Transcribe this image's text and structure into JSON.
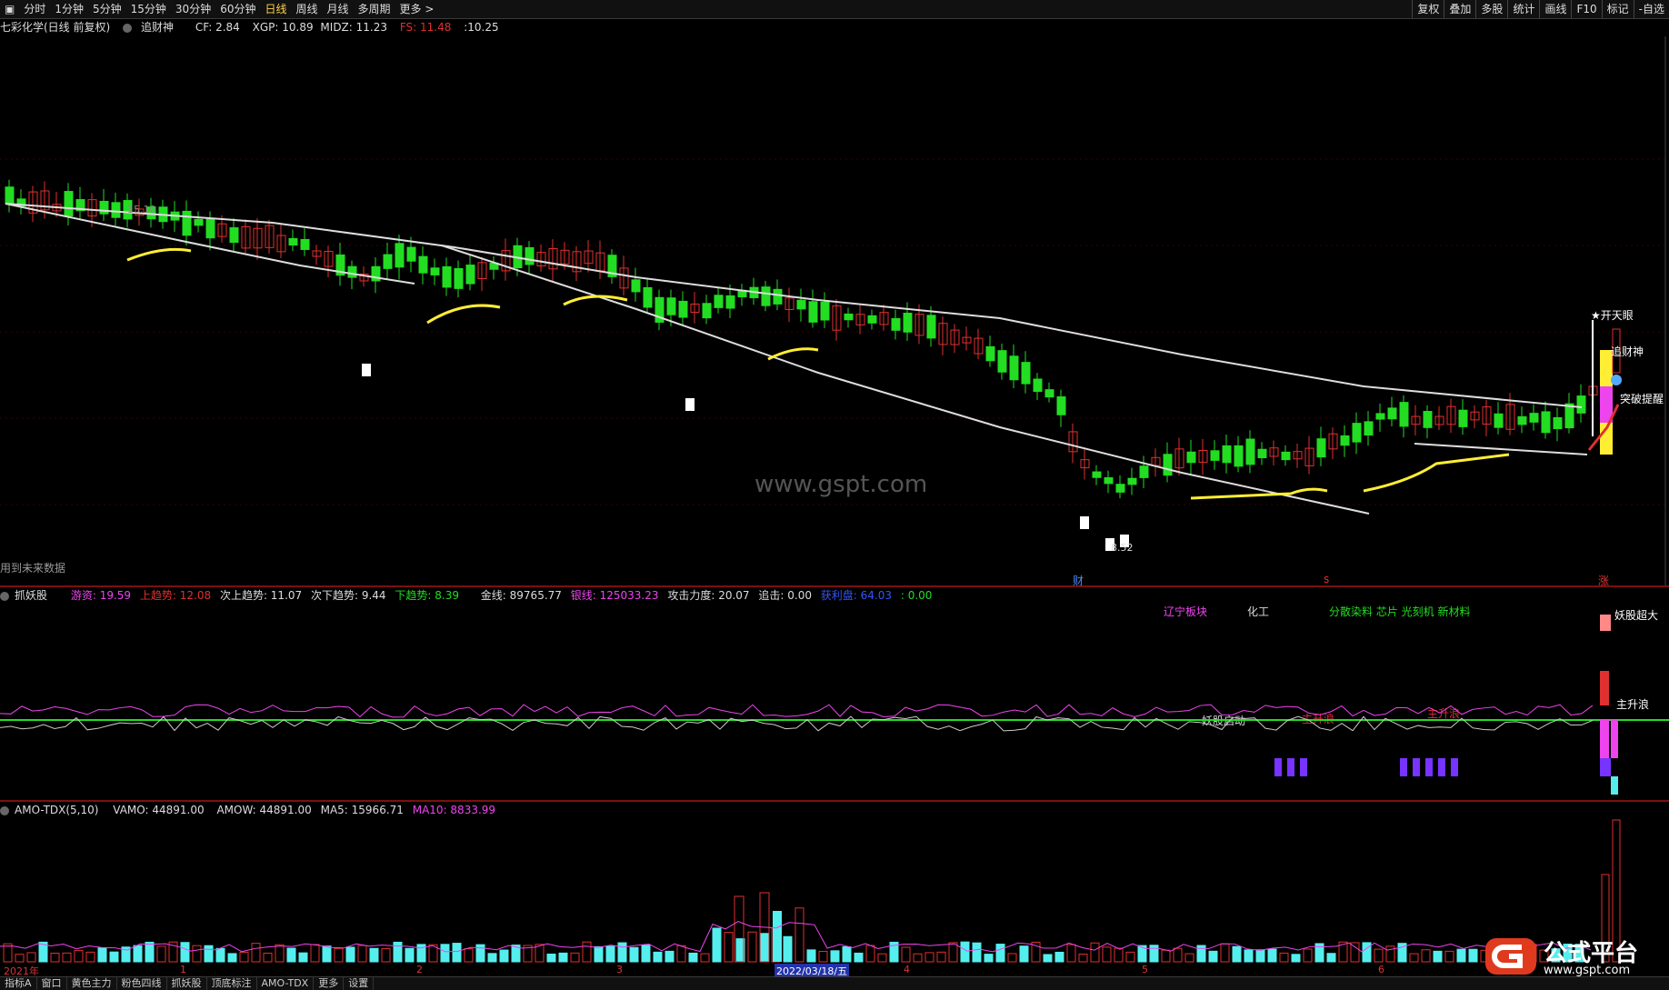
{
  "toolbar": {
    "periods": [
      "分时",
      "1分钟",
      "5分钟",
      "15分钟",
      "30分钟",
      "60分钟",
      "日线",
      "周线",
      "月线",
      "多周期",
      "更多 >"
    ],
    "active_period": "日线",
    "right_items": [
      "复权",
      "叠加",
      "多股",
      "统计",
      "画线",
      "F10",
      "标记",
      "-自选"
    ]
  },
  "main_info": {
    "stock": "七彩化学(日线 前复权)",
    "indicator": "追财神",
    "cf": "CF: 2.84",
    "xgp": "XGP: 10.89",
    "midz": "MIDZ: 11.23",
    "fs": "FS: 11.48",
    "last": ":10.25"
  },
  "main_annotations": {
    "high_label": "15.10",
    "low_label": "8.52",
    "future_note": "用到未来数据",
    "kaitianyan": "★开天眼",
    "zhuicaishen": "追财神",
    "tupo": "突破提醒",
    "cai": "财",
    "zhang": "涨",
    "mark_s": "s"
  },
  "watermark": "www.gspt.com",
  "ind1": {
    "name": "抓妖股",
    "youzi": "游资: 19.59",
    "shang": "上趋势: 12.08",
    "cishang": "次上趋势: 11.07",
    "cixia": "次下趋势: 9.44",
    "xia": "下趋势: 8.39",
    "jinxian": "金线: 89765.77",
    "yinxian": "银线: 125033.23",
    "gongji": "攻击力度: 20.07",
    "zhuiji": "追击: 0.00",
    "huoli": "获利盘: 64.03",
    "tail": ": 0.00",
    "sector1": "辽宁板块",
    "sector2": "化工",
    "sector3": "分散染料 芯片 光刻机 新材料",
    "yaogu_chaoda": "妖股超大",
    "yaogu_qidong": "妖股启动",
    "zhushenglang": "主升浪"
  },
  "ind2": {
    "name": "AMO-TDX(5,10)",
    "vamo": "VAMO: 44891.00",
    "amow": "AMOW: 44891.00",
    "ma5": "MA5: 15966.71",
    "ma10": "MA10: 8833.99"
  },
  "dates": {
    "d0": "2021年",
    "m1": "1",
    "m2": "2",
    "m3": "3",
    "cursor": "2022/03/18/五",
    "m4": "4",
    "m5": "5",
    "m6": "6"
  },
  "bottom_tabs": [
    "指标A",
    "窗口",
    "黄色主力",
    "粉色四线",
    "抓妖股",
    "顶底标注",
    "AMO-TDX",
    "更多",
    "设置"
  ],
  "logo": {
    "title": "公式平台",
    "url": "www.gspt.com"
  },
  "colors": {
    "up": "#e03030",
    "down": "#22dd22",
    "ma": "#ffffff",
    "yellow": "#ffee33",
    "magenta": "#ee44ee",
    "cyan": "#55eeee"
  }
}
